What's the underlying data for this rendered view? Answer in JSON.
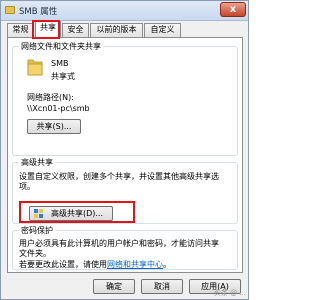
{
  "window": {
    "title": "SMB 属性",
    "close_glyph": "x"
  },
  "tabs": [
    {
      "label": "常规"
    },
    {
      "label": "共享"
    },
    {
      "label": "安全"
    },
    {
      "label": "以前的版本"
    },
    {
      "label": "自定义"
    }
  ],
  "network_share": {
    "group_title": "网络文件和文件夹共享",
    "folder_name": "SMB",
    "folder_status": "共享式",
    "path_label": "网络路径(N):",
    "path_value": "\\\\Xcn01-pc\\smb",
    "share_button": "共享(S)..."
  },
  "advanced_share": {
    "group_title": "高级共享",
    "description_line1": "设置自定义权限，创建多个共享，并设置其他高级共享选",
    "description_line2": "项。",
    "button_label": "高级共享(D)..."
  },
  "password": {
    "group_title": "密码保护",
    "line1": "用户必须具有此计算机的用户帐户和密码，才能访问共享",
    "line2": "文件夹。",
    "change_prefix": "若要更改此设置，请使用",
    "change_link": "网络和共享中心",
    "change_suffix": "。"
  },
  "footer": {
    "ok": "确定",
    "cancel": "取消",
    "apply": "应用(A)",
    "watermark": "头条 @ ..."
  },
  "colors": {
    "highlight": "#e0151a",
    "link": "#0066cc"
  }
}
